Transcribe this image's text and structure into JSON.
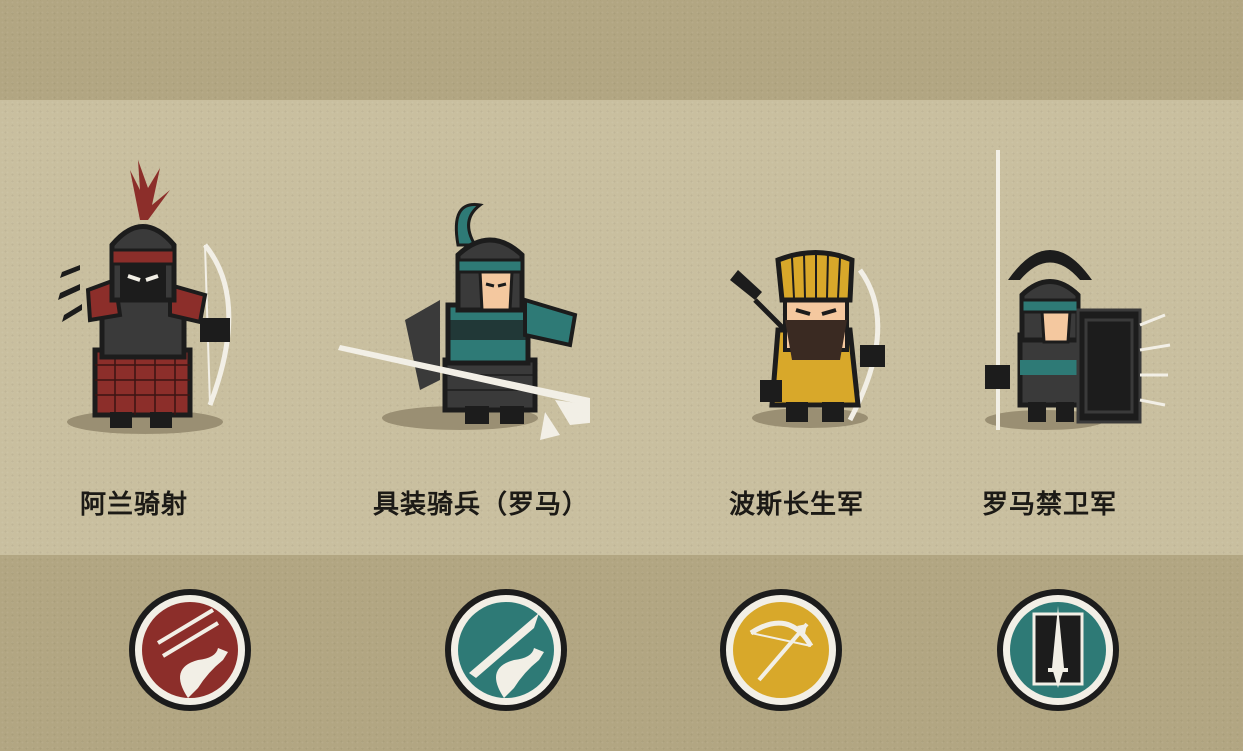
{
  "units": [
    {
      "name": "阿兰骑射",
      "class_icon": "horse-archer-icon",
      "color": "#8c2e2a"
    },
    {
      "name": "具装骑兵（罗马）",
      "class_icon": "lancer-cavalry-icon",
      "color": "#2e7a76"
    },
    {
      "name": "波斯长生军",
      "class_icon": "bow-icon",
      "color": "#d8a82a"
    },
    {
      "name": "罗马禁卫军",
      "class_icon": "shield-sword-icon",
      "color": "#2e7a76"
    }
  ]
}
